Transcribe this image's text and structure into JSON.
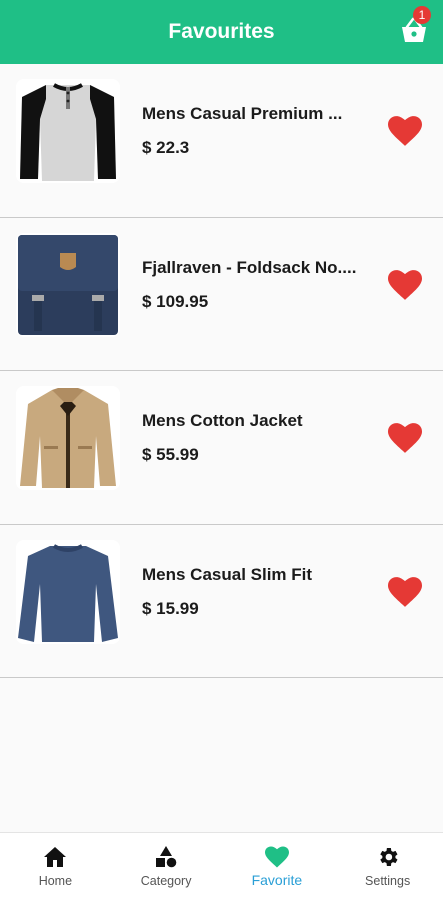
{
  "appbar": {
    "title": "Favourites",
    "cart_badge": "1"
  },
  "favorites": [
    {
      "title": "Mens Casual Premium ...",
      "price": "$ 22.3"
    },
    {
      "title": "Fjallraven - Foldsack No....",
      "price": "$ 109.95"
    },
    {
      "title": "Mens Cotton Jacket",
      "price": "$ 55.99"
    },
    {
      "title": "Mens Casual Slim Fit",
      "price": "$ 15.99"
    }
  ],
  "nav": {
    "items": [
      {
        "label": "Home",
        "icon": "home-icon"
      },
      {
        "label": "Category",
        "icon": "category-icon"
      },
      {
        "label": "Favorite",
        "icon": "heart-icon"
      },
      {
        "label": "Settings",
        "icon": "gear-icon"
      }
    ],
    "active_index": 2
  },
  "colors": {
    "primary": "#1fbf86",
    "heart": "#e53935",
    "active_label": "#2a9fd6",
    "badge": "#e53935"
  }
}
